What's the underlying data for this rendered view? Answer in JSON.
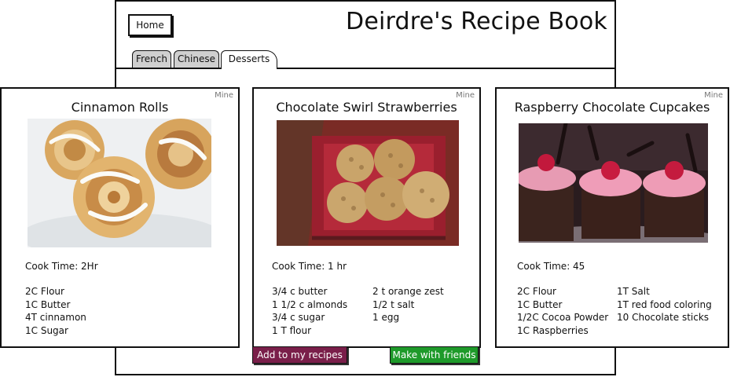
{
  "header": {
    "home_label": "Home",
    "title": "Deirdre's Recipe Book"
  },
  "tabs": [
    {
      "label": "French",
      "active": false
    },
    {
      "label": "Chinese",
      "active": false
    },
    {
      "label": "Desserts",
      "active": true
    }
  ],
  "cards": [
    {
      "badge": "Mine",
      "title": "Cinnamon Rolls",
      "cook_time": "Cook Time: 2Hr",
      "ingredients_col1": [
        "2C Flour",
        "1C Butter",
        "4T cinnamon",
        "1C Sugar"
      ],
      "ingredients_col2": []
    },
    {
      "badge": "Mine",
      "title": "Chocolate Swirl Strawberries",
      "cook_time": "Cook Time: 1 hr",
      "ingredients_col1": [
        "3/4 c butter",
        "1 1/2 c almonds",
        "3/4 c sugar",
        "1 T flour"
      ],
      "ingredients_col2": [
        "2 t orange zest",
        "1/2 t salt",
        "1 egg"
      ]
    },
    {
      "badge": "Mine",
      "title": "Raspberry Chocolate Cupcakes",
      "cook_time": "Cook Time: 45",
      "ingredients_col1": [
        "2C Flour",
        "1C Butter",
        "1/2C Cocoa Powder",
        "1C Raspberries"
      ],
      "ingredients_col2": [
        "1T Salt",
        "1T red food coloring",
        "10 Chocolate sticks"
      ]
    }
  ],
  "actions": {
    "add_label": "Add to my recipes",
    "add_color": "#7a1f4a",
    "friends_label": "Make with friends",
    "friends_color": "#1e9a2a"
  }
}
